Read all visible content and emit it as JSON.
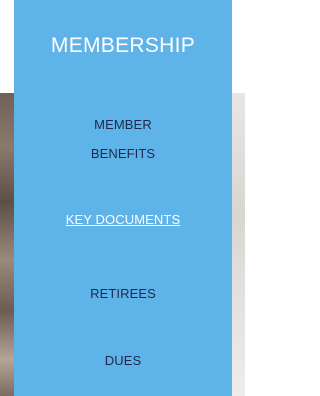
{
  "menu": {
    "title": "MEMBERSHIP",
    "items": [
      {
        "line1": "MEMBER",
        "line2": "BENEFITS"
      },
      {
        "label": "KEY DOCUMENTS",
        "active": true
      },
      {
        "label": "RETIREES"
      },
      {
        "label": "DUES"
      }
    ]
  },
  "colors": {
    "menu_background": "#5eb3e8",
    "item_text": "#1e2a4a",
    "active_text": "#ffffff",
    "header_text": "#ffffff"
  }
}
